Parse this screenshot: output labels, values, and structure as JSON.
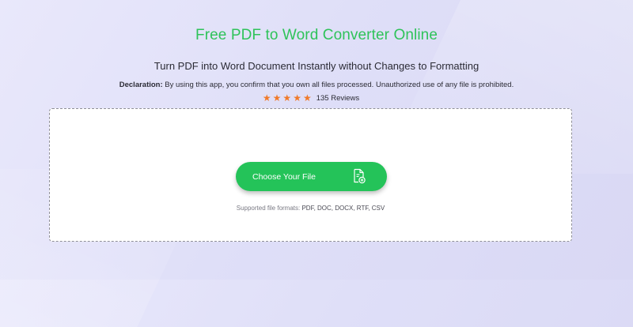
{
  "header": {
    "title": "Free PDF to Word Converter Online",
    "subtitle": "Turn PDF into Word Document Instantly without Changes to Formatting",
    "declaration_label": "Declaration:",
    "declaration_text": "By using this app, you confirm that you own all files processed. Unauthorized use of any file is prohibited."
  },
  "rating": {
    "stars": 5,
    "reviews": "135 Reviews",
    "star_color": "#f07a2a"
  },
  "upload": {
    "button_label": "Choose Your File",
    "button_icon": "file-add-icon",
    "formats_label": "Supported file formats:",
    "formats_list": "PDF, DOC, DOCX, RTF, CSV",
    "accent_color": "#24c359"
  }
}
